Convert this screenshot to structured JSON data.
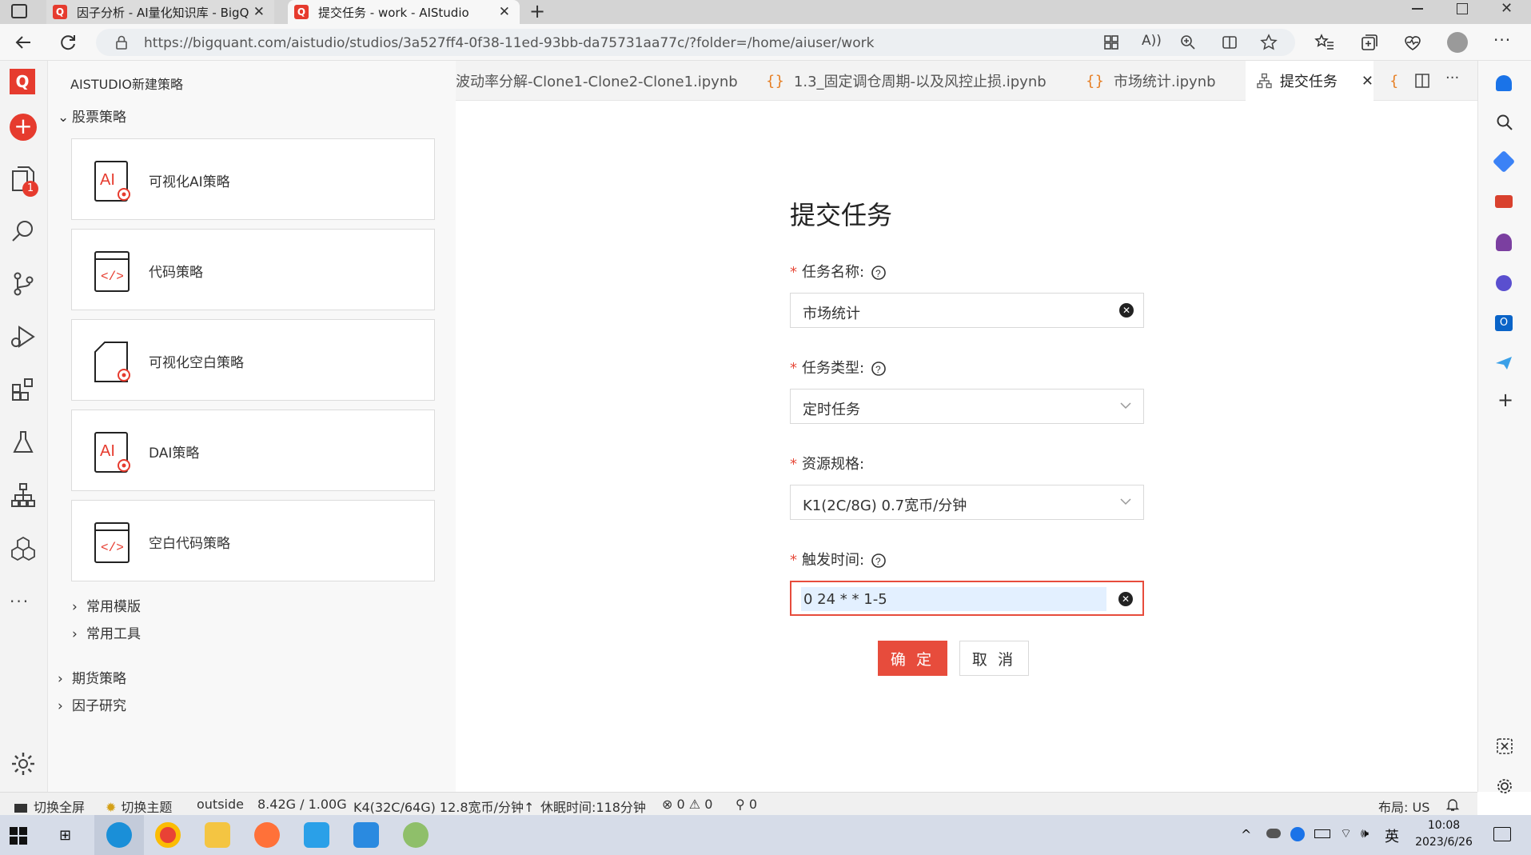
{
  "browser": {
    "tabs": [
      {
        "title": "因子分析 - AI量化知识库 - BigQu",
        "active": false
      },
      {
        "title": "提交任务 - work - AIStudio",
        "active": true
      }
    ],
    "url": "https://bigquant.com/aistudio/studios/3a527ff4-0f38-11ed-93bb-da75731aa77c/?folder=/home/aiuser/work"
  },
  "sidebar": {
    "title": "AISTUDIO新建策略",
    "section_stock": "股票策略",
    "cards": [
      {
        "label": "可视化AI策略",
        "icon": "ai-doc-icon"
      },
      {
        "label": "代码策略",
        "icon": "code-doc-icon"
      },
      {
        "label": "可视化空白策略",
        "icon": "blank-doc-icon"
      },
      {
        "label": "DAI策略",
        "icon": "ai-doc-icon"
      },
      {
        "label": "空白代码策略",
        "icon": "code-doc-icon"
      }
    ],
    "sub_items": [
      "常用模版",
      "常用工具"
    ],
    "sections": [
      "期货策略",
      "因子研究"
    ]
  },
  "activity": {
    "badge": "1"
  },
  "editor_tabs": [
    "波动率分解-Clone1-Clone2-Clone1.ipynb",
    "1.3_固定调仓周期-以及风控止损.ipynb",
    "市场统计.ipynb",
    "提交任务"
  ],
  "form": {
    "title": "提交任务",
    "fields": [
      {
        "label": "任务名称:",
        "value": "市场统计"
      },
      {
        "label": "任务类型:",
        "value": "定时任务"
      },
      {
        "label": "资源规格:",
        "value": "K1(2C/8G) 0.7宽币/分钟"
      },
      {
        "label": "触发时间:",
        "value": "0 24 * * 1-5"
      }
    ],
    "ok": "确 定",
    "cancel": "取 消"
  },
  "status": {
    "fullscreen": "切换全屏",
    "theme": "切换主题",
    "outside": "outside",
    "memory": "8.42G / 1.00G",
    "resource": "K4(32C/64G) 12.8宽币/分钟↑",
    "sleep": "休眠时间:118分钟",
    "errors": "0",
    "warnings": "0",
    "ports": "0",
    "layout": "布局: US"
  },
  "taskbar": {
    "ime": "英",
    "time": "10:08",
    "date": "2023/6/26"
  },
  "colors": {
    "accent": "#e74c3c",
    "brand": "#e63b2e"
  }
}
